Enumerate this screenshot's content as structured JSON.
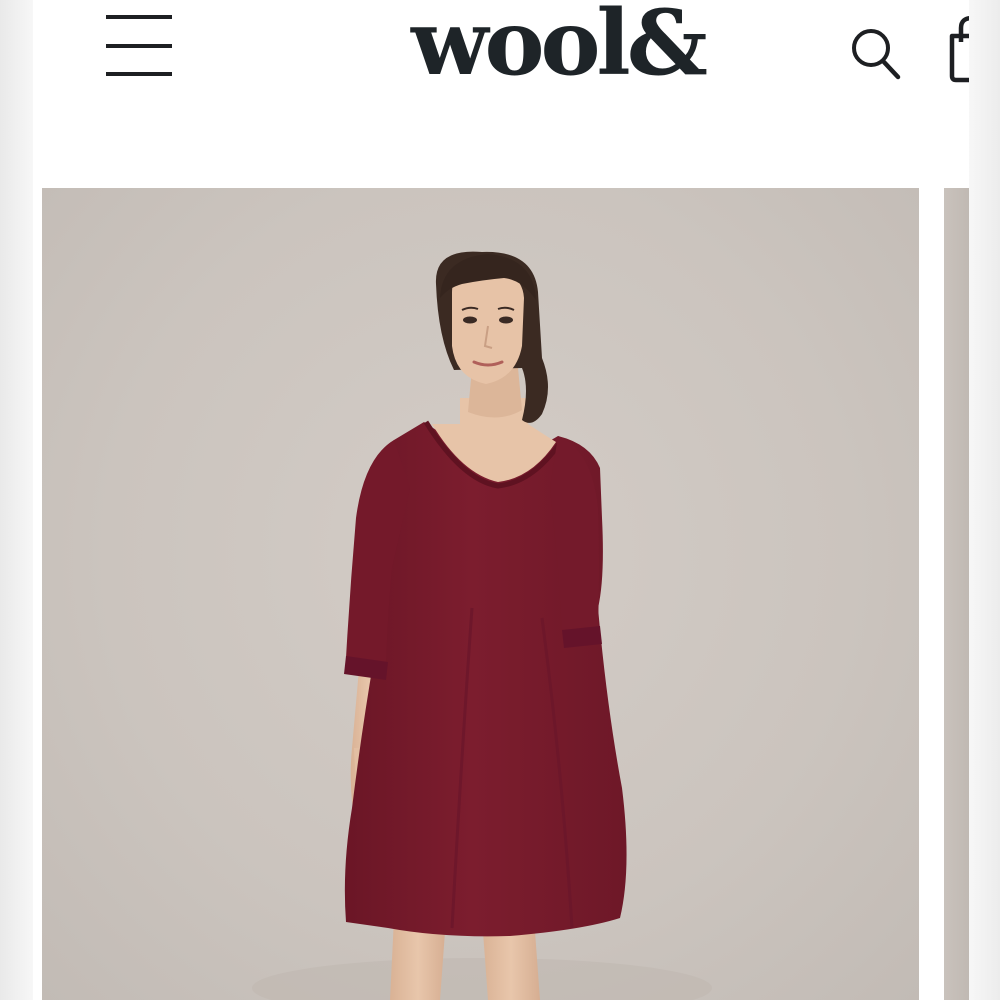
{
  "header": {
    "brand": "wool&",
    "menu_icon": "hamburger-menu-icon",
    "search_icon": "search-icon",
    "cart_icon": "shopping-bag-icon"
  },
  "product_gallery": {
    "image_subject": "model-in-burgundy-three-quarter-sleeve-dress",
    "colors": {
      "backdrop": "#cbc4be",
      "dress": "#7a1c2c",
      "skin": "#e6c3a8",
      "hair": "#3b2a22"
    }
  }
}
